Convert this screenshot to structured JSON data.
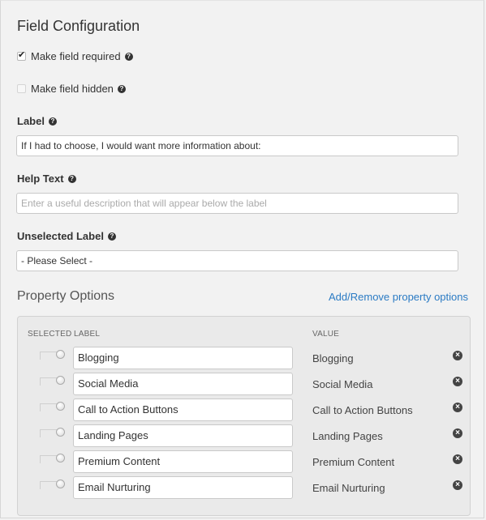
{
  "title": "Field Configuration",
  "required": {
    "label": "Make field required",
    "checked": true
  },
  "hidden": {
    "label": "Make field hidden",
    "checked": false
  },
  "label_field": {
    "label": "Label",
    "value": "If I had to choose, I would want more information about:"
  },
  "help_field": {
    "label": "Help Text",
    "placeholder": "Enter a useful description that will appear below the label"
  },
  "unselected_field": {
    "label": "Unselected Label",
    "value": "- Please Select -"
  },
  "property_options": {
    "title": "Property Options",
    "link": "Add/Remove property options",
    "headers": {
      "selected": "SELECTED",
      "label": "LABEL",
      "value": "VALUE"
    },
    "options": [
      {
        "label": "Blogging",
        "value": "Blogging"
      },
      {
        "label": "Social Media",
        "value": "Social Media"
      },
      {
        "label": "Call to Action Buttons",
        "value": "Call to Action Buttons"
      },
      {
        "label": "Landing Pages",
        "value": "Landing Pages"
      },
      {
        "label": "Premium Content",
        "value": "Premium Content"
      },
      {
        "label": "Email Nurturing",
        "value": "Email Nurturing"
      }
    ]
  },
  "icons": {
    "help": "question-circle-icon",
    "remove": "remove-circle-icon"
  }
}
